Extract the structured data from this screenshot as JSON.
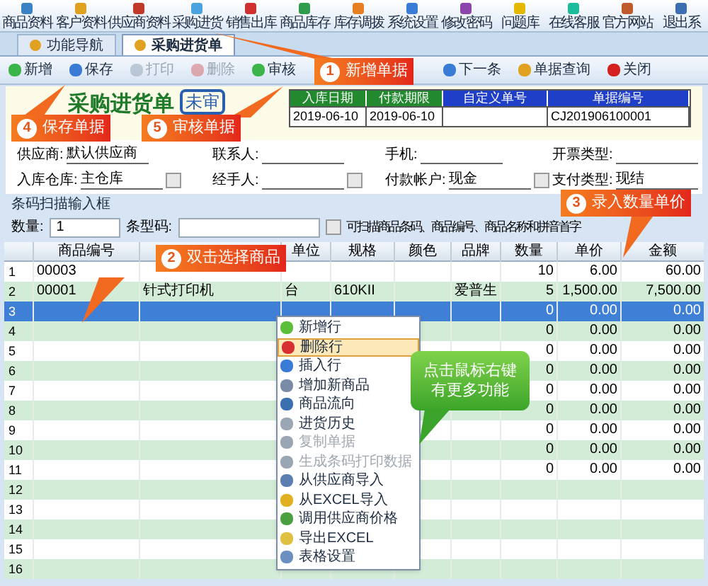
{
  "nav": [
    {
      "label": "商品资料"
    },
    {
      "label": "客户资料"
    },
    {
      "label": "供应商资料"
    },
    {
      "label": "采购进货"
    },
    {
      "label": "销售出库"
    },
    {
      "label": "商品库存"
    },
    {
      "label": "库存调拨"
    },
    {
      "label": "系统设置"
    },
    {
      "label": "修改密码"
    },
    {
      "label": "问题库"
    },
    {
      "label": "在线客服"
    },
    {
      "label": "官方网站"
    },
    {
      "label": "退出系"
    }
  ],
  "tabs": [
    {
      "label": "功能导航",
      "selected": false
    },
    {
      "label": "采购进货单",
      "selected": true
    }
  ],
  "toolbar": [
    {
      "label": "新增",
      "disabled": false
    },
    {
      "label": "保存",
      "disabled": false
    },
    {
      "label": "打印",
      "disabled": true
    },
    {
      "label": "删除",
      "disabled": true
    },
    {
      "label": "审核",
      "disabled": false
    },
    {
      "label": "下一条",
      "disabled": false
    },
    {
      "label": "单据查询",
      "disabled": false
    },
    {
      "label": "关闭",
      "disabled": false
    }
  ],
  "document": {
    "title": "采购进货单",
    "stamp": "未审",
    "fields": [
      {
        "label": "入库日期",
        "value": "2019-06-10",
        "color": "#22892f"
      },
      {
        "label": "付款期限",
        "value": "2019-06-10",
        "color": "#22892f"
      },
      {
        "label": "自定义单号",
        "color": "#1f3fc8"
      },
      {
        "label": "单据编号",
        "value": "CJ201906100001",
        "color": "#1f3fc8"
      }
    ]
  },
  "form_rows": [
    [
      {
        "label": "供应商:",
        "value": "默认供应商",
        "lookup": false
      },
      {
        "label": "联系人:",
        "lookup": false
      },
      {
        "label": "手机:",
        "lookup": false
      },
      {
        "label": "开票类型:",
        "lookup": false
      }
    ],
    [
      {
        "label": "入库仓库:",
        "value": "主仓库",
        "lookup": true
      },
      {
        "label": "经手人:",
        "lookup": true
      },
      {
        "label": "付款帐户:",
        "value": "现金",
        "lookup": true
      },
      {
        "label": "支付类型:",
        "value": "现结",
        "lookup": false
      }
    ]
  ],
  "barcode": {
    "title": "条码扫描输入框",
    "quantity_label": "数量:",
    "quantity": "1",
    "code_label": "条型码:",
    "hint": "可扫描商品条码、商品编号、商品名称和拼音首字"
  },
  "table": {
    "columns": [
      "商品编号",
      "单位",
      "规格",
      "颜色",
      "品牌",
      "数量",
      "单价",
      "金额"
    ],
    "rows": [
      {
        "number": "1",
        "code": "00003",
        "qty": "10",
        "price": "6.00",
        "amount": "60.00",
        "selected": false
      },
      {
        "number": "2",
        "code": "00001",
        "name": "针式打印机",
        "unit": "台",
        "spec": "610KII",
        "brand": "爱普生",
        "qty": "5",
        "price": "1,500.00",
        "amount": "7,500.00",
        "selected": false
      },
      {
        "number": "3",
        "qty": "0",
        "price": "0.00",
        "amount": "0.00",
        "selected": true
      },
      {
        "number": "4",
        "qty": "0",
        "price": "0.00",
        "amount": "0.00",
        "selected": false
      },
      {
        "number": "5",
        "qty": "0",
        "price": "0.00",
        "amount": "0.00",
        "selected": false
      },
      {
        "number": "6",
        "qty": "0",
        "price": "0.00",
        "amount": "0.00",
        "selected": false
      },
      {
        "number": "7",
        "qty": "0",
        "price": "0.00",
        "amount": "0.00",
        "selected": false
      },
      {
        "number": "8",
        "qty": "0",
        "price": "0.00",
        "amount": "0.00",
        "selected": false
      },
      {
        "number": "9",
        "qty": "0",
        "price": "0.00",
        "amount": "0.00",
        "selected": false
      },
      {
        "number": "10",
        "qty": "0",
        "price": "0.00",
        "amount": "0.00",
        "selected": false
      },
      {
        "number": "11",
        "qty": "0",
        "price": "0.00",
        "amount": "0.00",
        "selected": false
      },
      {
        "number": "12",
        "selected": false
      },
      {
        "number": "13",
        "selected": false
      },
      {
        "number": "14",
        "selected": false
      },
      {
        "number": "15",
        "selected": false
      },
      {
        "number": "16",
        "selected": false
      }
    ]
  },
  "context_menu": [
    {
      "label": "新增行",
      "selected": false,
      "disabled": false
    },
    {
      "label": "删除行",
      "selected": true,
      "disabled": false
    },
    {
      "label": "插入行",
      "selected": false,
      "disabled": false
    },
    {
      "label": "增加新商品",
      "selected": false,
      "disabled": false
    },
    {
      "label": "商品流向",
      "selected": false,
      "disabled": false
    },
    {
      "label": "进货历史",
      "selected": false,
      "disabled": false
    },
    {
      "label": "复制单据",
      "selected": false,
      "disabled": true
    },
    {
      "label": "生成条码打印数据",
      "selected": false,
      "disabled": true
    },
    {
      "label": "从供应商导入",
      "selected": false,
      "disabled": false
    },
    {
      "label": "从EXCEL导入",
      "selected": false,
      "disabled": false
    },
    {
      "label": "调用供应商价格",
      "selected": false,
      "disabled": false
    },
    {
      "label": "导出EXCEL",
      "selected": false,
      "disabled": false
    },
    {
      "label": "表格设置",
      "selected": false,
      "disabled": false
    }
  ],
  "annotations": [
    {
      "number": "1",
      "text": "新增单据"
    },
    {
      "number": "4",
      "text": "保存单据"
    },
    {
      "number": "5",
      "text": "审核单据"
    },
    {
      "number": "3",
      "text": "录入数量单价"
    },
    {
      "number": "2",
      "text": "双击选择商品"
    }
  ],
  "tip": {
    "lines": [
      "点击鼠标右键",
      "有更多功能"
    ]
  }
}
